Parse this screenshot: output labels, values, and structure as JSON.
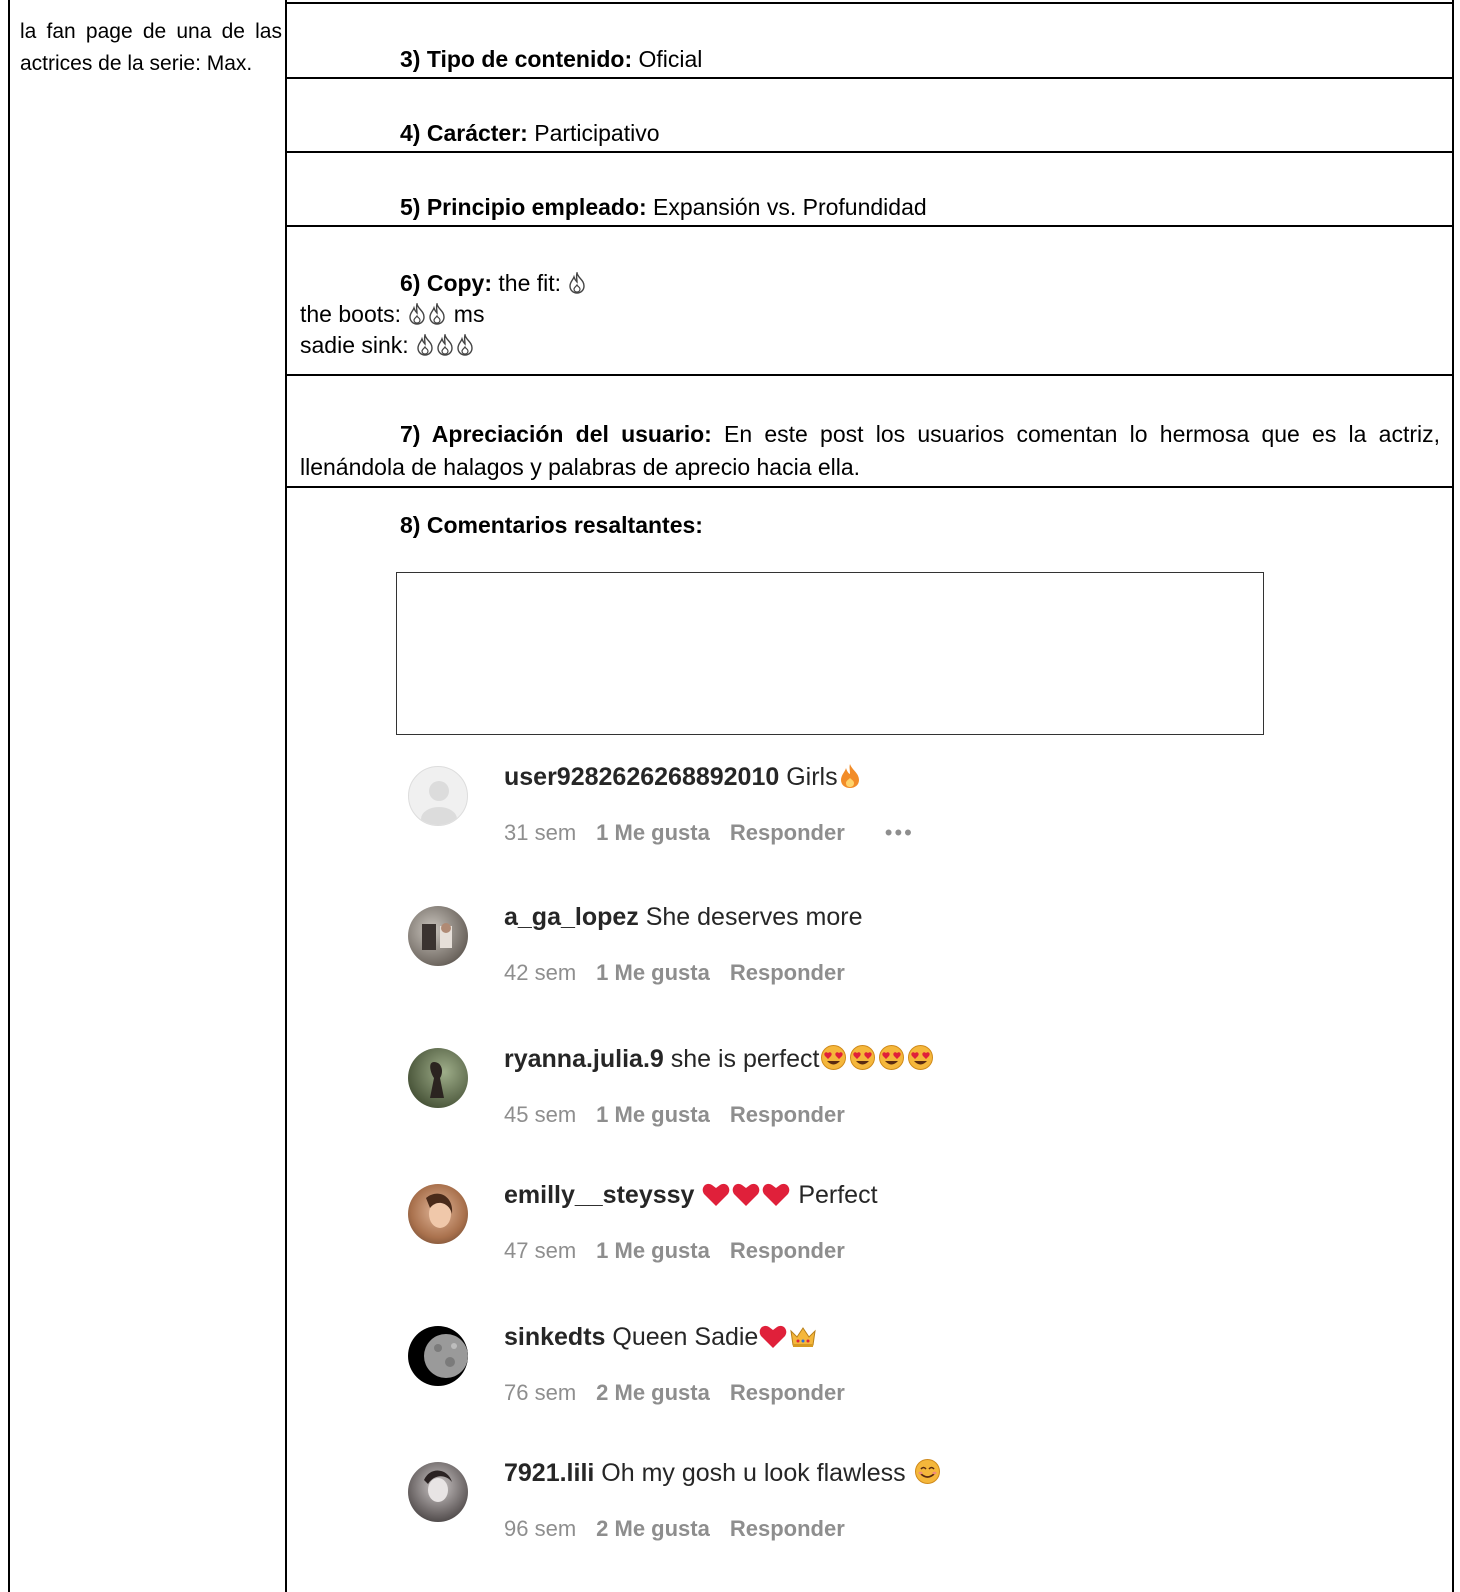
{
  "left_cell": {
    "text": "la fan page de una de las actrices de la serie: Max."
  },
  "rows": {
    "tipo": {
      "label": "3) Tipo de contenido:",
      "value": " Oficial"
    },
    "caracter": {
      "label": "4) Carácter:",
      "value": " Participativo"
    },
    "principio": {
      "label": "5) Principio empleado:",
      "value": " Expansión vs. Profundidad"
    },
    "copy": {
      "label": "6) Copy:",
      "line1": " the fit: ",
      "line2": "the boots: ",
      "line2_suffix": " ms",
      "line3": "sadie sink: "
    },
    "apreciacion": {
      "label": "7) Apreciación del usuario:",
      "value": " En este post los usuarios comentan lo hermosa que es la actriz, llenándola de halagos y palabras de aprecio hacia ella."
    },
    "comentarios": {
      "label": "8) Comentarios resaltantes:"
    }
  },
  "comments": [
    {
      "user": "user9282626268892010",
      "text": " Girls",
      "emojis": [
        "fire"
      ],
      "time": "31 sem",
      "likes": "1 Me gusta",
      "reply": "Responder",
      "more": "•••"
    },
    {
      "user": "a_ga_lopez",
      "text": " She deserves more",
      "emojis": [],
      "time": "42 sem",
      "likes": "1 Me gusta",
      "reply": "Responder"
    },
    {
      "user": "ryanna.julia.9",
      "text": " she is perfect",
      "emojis": [
        "heart-eyes",
        "heart-eyes",
        "heart-eyes",
        "heart-eyes"
      ],
      "time": "45 sem",
      "likes": "1 Me gusta",
      "reply": "Responder"
    },
    {
      "user": "emilly__steyssy",
      "text": " Perfect",
      "emojis_before_text": [
        "red-heart",
        "red-heart",
        "red-heart"
      ],
      "time": "47 sem",
      "likes": "1 Me gusta",
      "reply": "Responder"
    },
    {
      "user": "sinkedts",
      "text": " Queen Sadie",
      "emojis": [
        "red-heart",
        "crown"
      ],
      "time": "76 sem",
      "likes": "2 Me gusta",
      "reply": "Responder"
    },
    {
      "user": "7921.lili",
      "text": " Oh my gosh u look flawless ",
      "emojis": [
        "smiling-face"
      ],
      "time": "96 sem",
      "likes": "2 Me gusta",
      "reply": "Responder"
    }
  ],
  "colors": {
    "username": "#262626",
    "meta": "#8e8e8e",
    "fire": "#f28c28",
    "heart": "#e0203a",
    "emoji_face": "#f5b73b"
  }
}
